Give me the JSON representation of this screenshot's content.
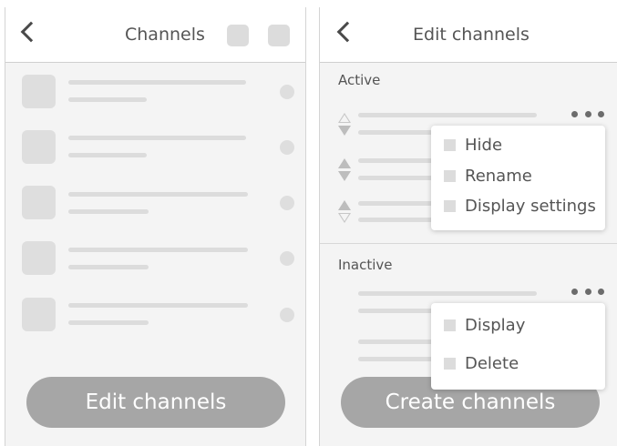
{
  "left_screen": {
    "header": {
      "title": "Channels"
    },
    "button": {
      "label": "Edit channels"
    }
  },
  "right_screen": {
    "header": {
      "title": "Edit channels"
    },
    "active": {
      "label": "Active",
      "menu": {
        "items": [
          "Hide",
          "Rename",
          "Display settings"
        ]
      }
    },
    "inactive": {
      "label": "Inactive",
      "menu": {
        "items": [
          "Display",
          "Delete"
        ]
      }
    },
    "button": {
      "label": "Create channels"
    }
  },
  "colors": {
    "screen_background": "#f4f4f4",
    "placeholder": "#dcdcdc",
    "button": "#a6a6a6",
    "text": "#555555"
  }
}
